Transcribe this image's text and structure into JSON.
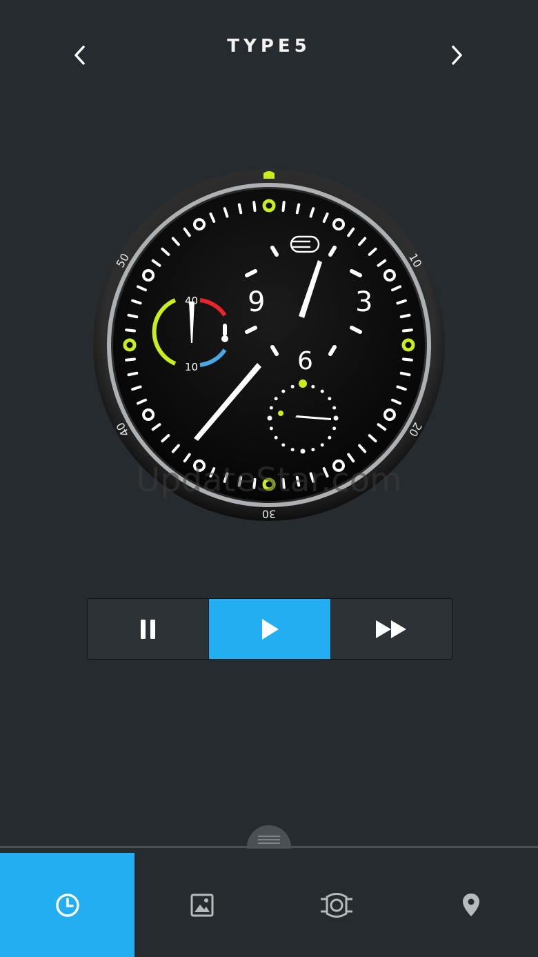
{
  "header": {
    "title": "TYPE5"
  },
  "watch": {
    "bezel_numbers": [
      "10",
      "20",
      "30",
      "40",
      "50"
    ],
    "hour_numerals": [
      "3",
      "6",
      "9"
    ],
    "temperature_labels": [
      "40",
      "10"
    ],
    "accent_color": "#c8ee1c"
  },
  "watermark": "UpdateStar.com",
  "controls": {
    "items": [
      {
        "name": "pause",
        "icon": "pause-icon"
      },
      {
        "name": "play",
        "icon": "play-icon",
        "active": true
      },
      {
        "name": "fast-forward",
        "icon": "fast-forward-icon"
      }
    ],
    "active_color": "#22aef0"
  },
  "tabs": [
    {
      "name": "clock",
      "icon": "clock-icon",
      "active": true
    },
    {
      "name": "image",
      "icon": "image-icon"
    },
    {
      "name": "watch-strap",
      "icon": "watch-strap-icon"
    },
    {
      "name": "location",
      "icon": "location-pin-icon"
    }
  ]
}
